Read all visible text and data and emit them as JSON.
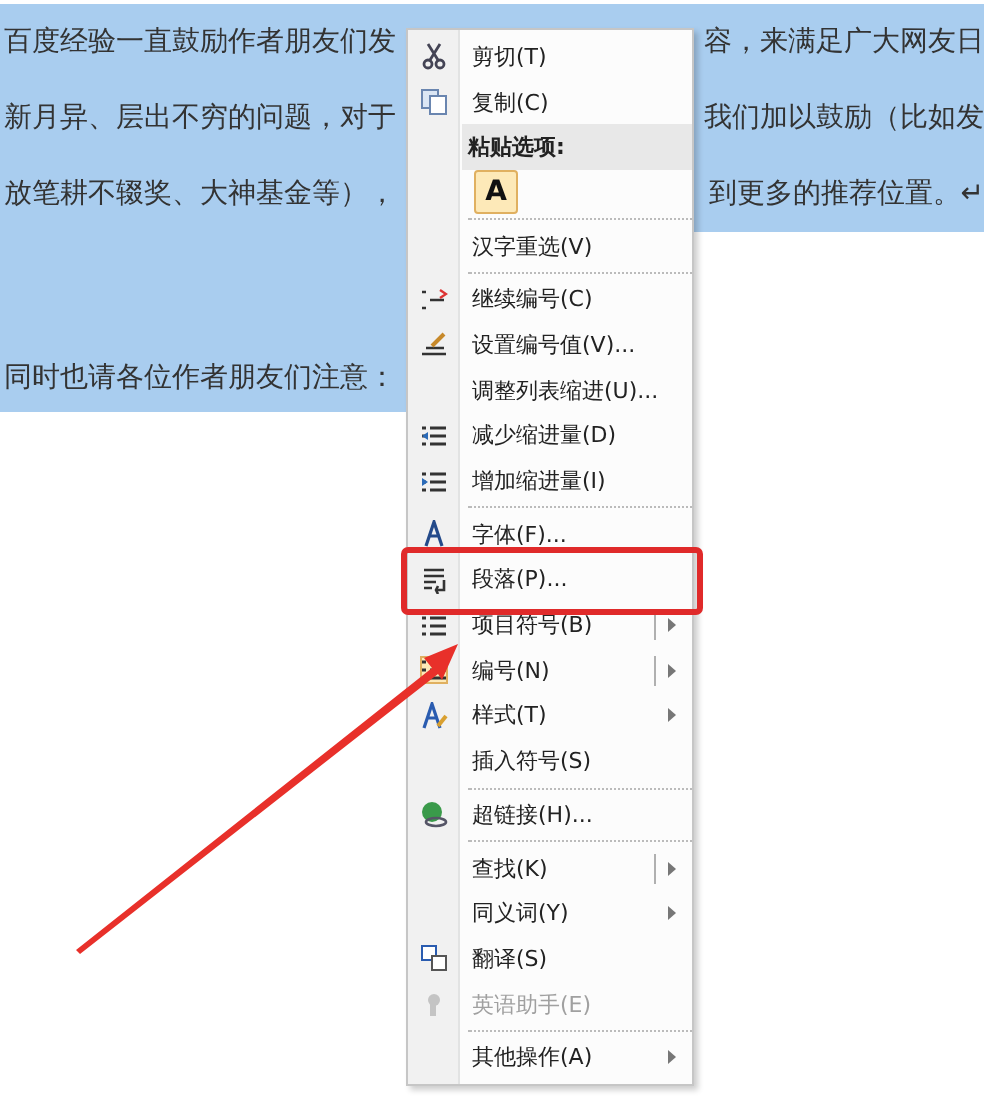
{
  "document": {
    "lines": [
      {
        "left": "百度经验一直鼓励作者朋友们发",
        "right": "容，来满足广大网友日"
      },
      {
        "left": "新月异、层出不穷的问题，对于",
        "right": "我们加以鼓励（比如发"
      },
      {
        "left": "放笔耕不辍奖、大神基金等），",
        "right": "到更多的推荐位置。↵"
      },
      {
        "left": "同时也请各位作者朋友们注意："
      }
    ]
  },
  "context_menu": {
    "items": [
      {
        "kind": "command",
        "label": "剪切(T)"
      },
      {
        "kind": "command",
        "label": "复制(C)"
      },
      {
        "kind": "header",
        "label": "粘贴选项:"
      },
      {
        "kind": "paste",
        "label": "A"
      },
      {
        "kind": "separator"
      },
      {
        "kind": "command",
        "label": "汉字重选(V)"
      },
      {
        "kind": "separator"
      },
      {
        "kind": "command",
        "label": "继续编号(C)"
      },
      {
        "kind": "command",
        "label": "设置编号值(V)..."
      },
      {
        "kind": "command",
        "label": "调整列表缩进(U)..."
      },
      {
        "kind": "command",
        "label": "减少缩进量(D)"
      },
      {
        "kind": "command",
        "label": "增加缩进量(I)"
      },
      {
        "kind": "separator"
      },
      {
        "kind": "command",
        "label": "字体(F)..."
      },
      {
        "kind": "command",
        "label": "段落(P)...",
        "highlighted": true
      },
      {
        "kind": "command",
        "label": "项目符号(B)",
        "submenu": true,
        "split": true
      },
      {
        "kind": "command",
        "label": "编号(N)",
        "submenu": true,
        "split": true
      },
      {
        "kind": "command",
        "label": "样式(T)",
        "submenu": true
      },
      {
        "kind": "command",
        "label": "插入符号(S)"
      },
      {
        "kind": "separator"
      },
      {
        "kind": "command",
        "label": "超链接(H)..."
      },
      {
        "kind": "separator"
      },
      {
        "kind": "command",
        "label": "查找(K)",
        "submenu": true,
        "split": true
      },
      {
        "kind": "command",
        "label": "同义词(Y)",
        "submenu": true
      },
      {
        "kind": "command",
        "label": "翻译(S)"
      },
      {
        "kind": "command",
        "label": "英语助手(E)",
        "disabled": true
      },
      {
        "kind": "separator"
      },
      {
        "kind": "command",
        "label": "其他操作(A)",
        "submenu": true
      }
    ]
  }
}
